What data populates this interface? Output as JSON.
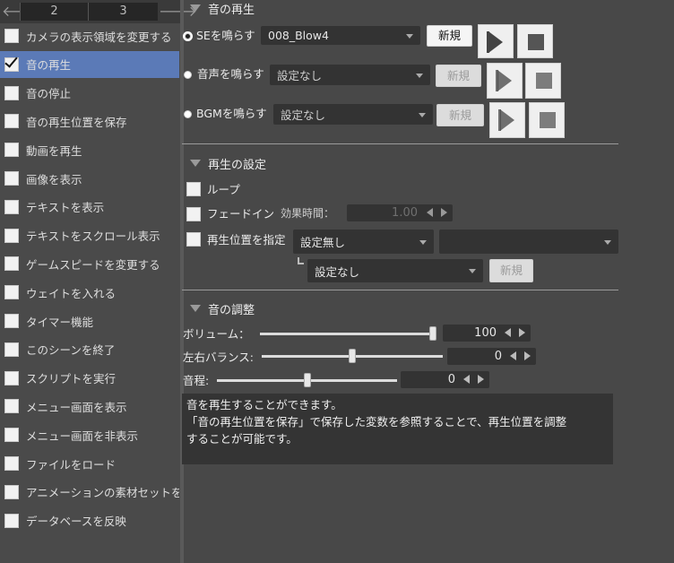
{
  "pager": {
    "pages": [
      "2",
      "3"
    ],
    "prev_icon": "arrow-left-icon",
    "next_icon": "arrow-right-icon"
  },
  "commands": [
    {
      "label": "カメラの表示領域を変更する",
      "checked": false,
      "selected": false
    },
    {
      "label": "音の再生",
      "checked": true,
      "selected": true
    },
    {
      "label": "音の停止",
      "checked": false,
      "selected": false
    },
    {
      "label": "音の再生位置を保存",
      "checked": false,
      "selected": false
    },
    {
      "label": "動画を再生",
      "checked": false,
      "selected": false
    },
    {
      "label": "画像を表示",
      "checked": false,
      "selected": false
    },
    {
      "label": "テキストを表示",
      "checked": false,
      "selected": false
    },
    {
      "label": "テキストをスクロール表示",
      "checked": false,
      "selected": false
    },
    {
      "label": "ゲームスピードを変更する",
      "checked": false,
      "selected": false
    },
    {
      "label": "ウェイトを入れる",
      "checked": false,
      "selected": false
    },
    {
      "label": "タイマー機能",
      "checked": false,
      "selected": false
    },
    {
      "label": "このシーンを終了",
      "checked": false,
      "selected": false
    },
    {
      "label": "スクリプトを実行",
      "checked": false,
      "selected": false
    },
    {
      "label": "メニュー画面を表示",
      "checked": false,
      "selected": false
    },
    {
      "label": "メニュー画面を非表示",
      "checked": false,
      "selected": false
    },
    {
      "label": "ファイルをロード",
      "checked": false,
      "selected": false
    },
    {
      "label": "アニメーションの素材セットを",
      "checked": false,
      "selected": false
    },
    {
      "label": "データベースを反映",
      "checked": false,
      "selected": false
    }
  ],
  "playback": {
    "title": "音の再生",
    "se": {
      "label": "SEを鳴らす",
      "value": "008_Blow4",
      "new_label": "新規",
      "selected": true
    },
    "voice": {
      "label": "音声を鳴らす",
      "value": "設定なし",
      "new_label": "新規",
      "selected": false
    },
    "bgm": {
      "label": "BGMを鳴らす",
      "value": "設定なし",
      "new_label": "新規",
      "selected": false
    }
  },
  "settings": {
    "title": "再生の設定",
    "loop_label": "ループ",
    "fade_label": "フェードイン",
    "fade_time_label": "効果時間：",
    "fade_time_value": "1.00",
    "position_label": "再生位置を指定",
    "position_value": "設定無し",
    "position_second_value": "",
    "variable_value": "設定なし",
    "variable_new_label": "新規"
  },
  "adjust": {
    "title": "音の調整",
    "volume_label": "ボリューム：",
    "volume_value": "100",
    "volume_level": 100,
    "balance_label": "左右バランス:",
    "balance_value": "0",
    "balance_level": 0,
    "pitch_label": "音程:",
    "pitch_value": "0",
    "pitch_level": 0
  },
  "description": {
    "line1": "音を再生することができます。",
    "line2": "「音の再生位置を保存」で保存した変数を参照することで、再生位置を調整",
    "line3": "することが可能です。"
  },
  "colors": {
    "selected_row": "#5b7ab7",
    "background": "#484848"
  }
}
